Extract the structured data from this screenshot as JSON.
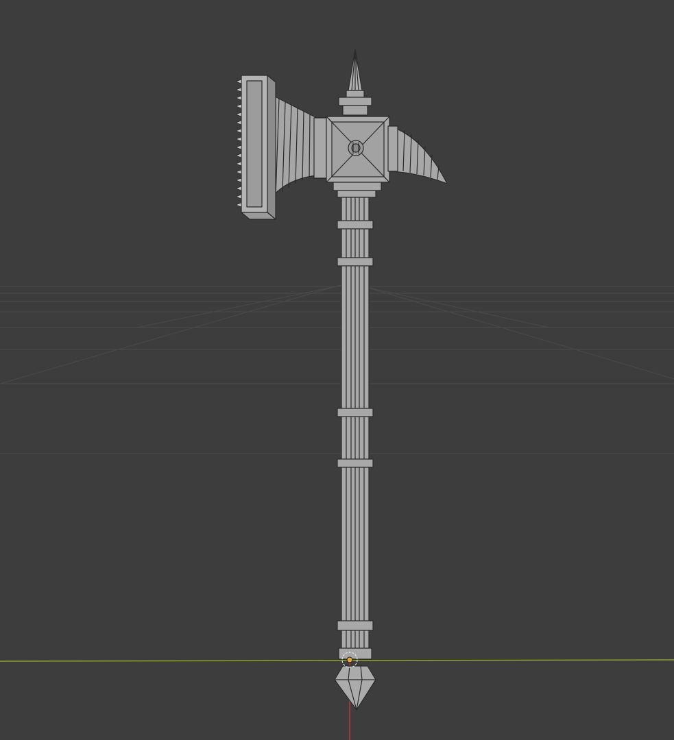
{
  "viewport": {
    "kind": "3d-viewport",
    "background": "#3d3d3d",
    "grid_color": "#4a4a4a",
    "x_axis_color": "#8fa62d",
    "z_axis_color": "#b8383f",
    "wireframe_overlay": true
  },
  "model": {
    "kind": "battle-axe",
    "mesh_color": "#a8a8a8",
    "edge_color": "#2a2a2a",
    "parts": [
      "spear-tip",
      "axe-blade",
      "serrated-edge",
      "head-block",
      "rear-spike",
      "handle",
      "handle-rings",
      "pommel-spike"
    ]
  },
  "origin": {
    "icon": "object-origin-icon",
    "color": "#e8a23a"
  }
}
